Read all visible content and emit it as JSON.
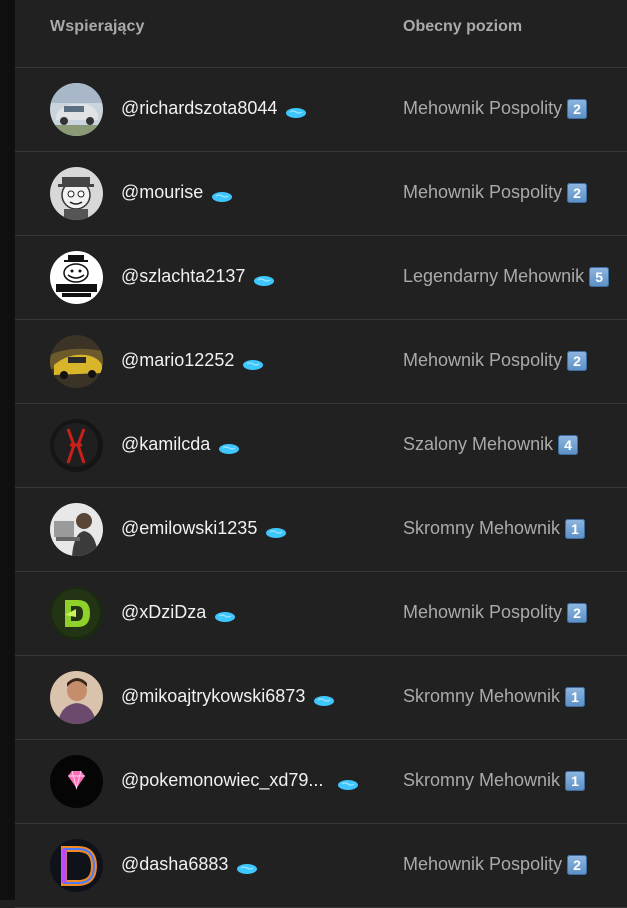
{
  "header": {
    "col_supporters": "Wspierający",
    "col_level": "Obecny poziom"
  },
  "rows": [
    {
      "username": "@richardszota8044",
      "level": "Mehownik Pospolity",
      "tier": "2",
      "avatar": "silver-car-avatar"
    },
    {
      "username": "@mourise",
      "level": "Mehownik Pospolity",
      "tier": "2",
      "avatar": "cartoon-character-avatar"
    },
    {
      "username": "@szlachta2137",
      "level": "Legendarny Mehownik",
      "tier": "5",
      "avatar": "szlachta-logo-avatar",
      "avatar_text": "SZLACHTA"
    },
    {
      "username": "@mario12252",
      "level": "Mehownik Pospolity",
      "tier": "2",
      "avatar": "yellow-car-avatar"
    },
    {
      "username": "@kamilcda",
      "level": "Szalony Mehownik",
      "tier": "4",
      "avatar": "red-symbol-avatar"
    },
    {
      "username": "@emilowski1235",
      "level": "Skromny Mehownik",
      "tier": "1",
      "avatar": "person-laptop-avatar"
    },
    {
      "username": "@xDziDza",
      "level": "Mehownik Pospolity",
      "tier": "2",
      "avatar": "green-d-logo-avatar"
    },
    {
      "username": "@mikoajtrykowski6873",
      "level": "Skromny Mehownik",
      "tier": "1",
      "avatar": "person-photo-avatar"
    },
    {
      "username": "@pokemonowiec_xd79...",
      "level": "Skromny Mehownik",
      "tier": "1",
      "avatar": "pink-gem-avatar"
    },
    {
      "username": "@dasha6883",
      "level": "Mehownik Pospolity",
      "tier": "2",
      "avatar": "fire-d-avatar"
    }
  ],
  "colors": {
    "background": "#212121",
    "text_primary": "#f1f1f1",
    "text_secondary": "#aaaaaa",
    "badge": "#3ea6ff",
    "divider": "#383838"
  }
}
